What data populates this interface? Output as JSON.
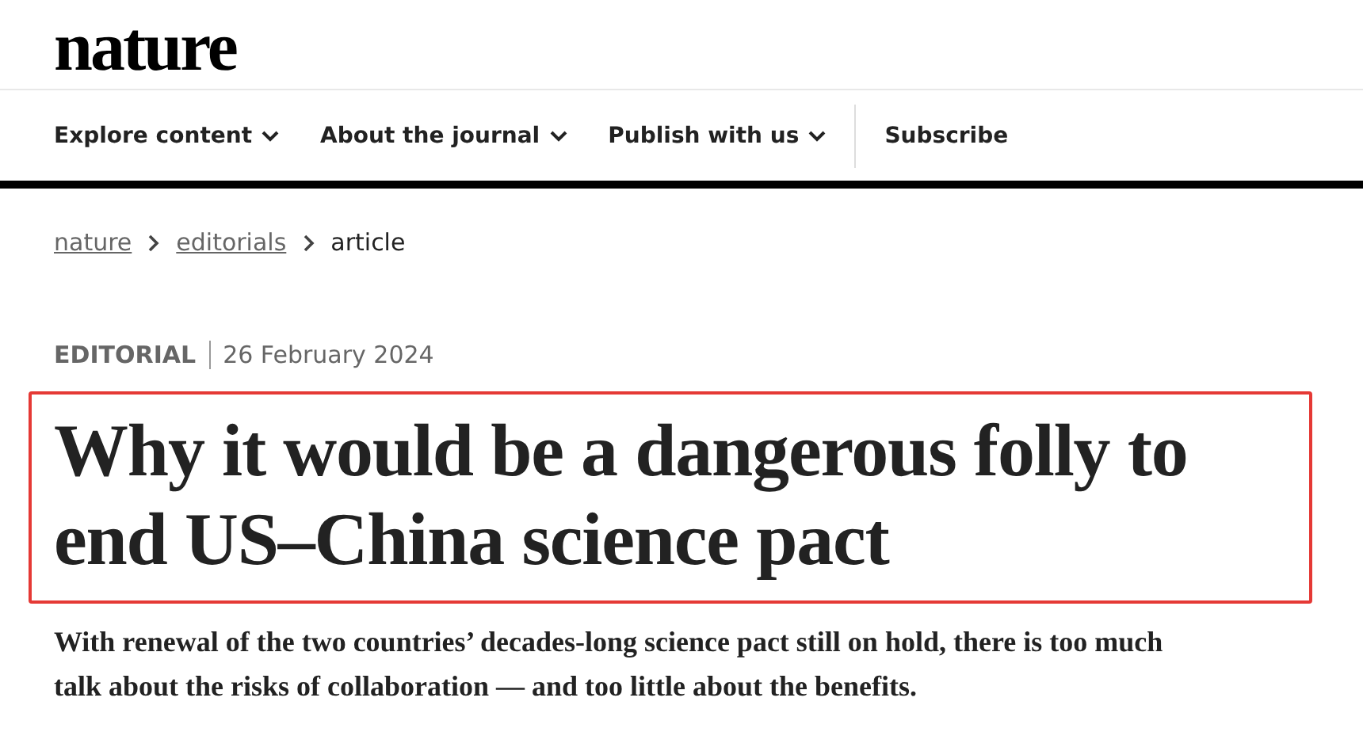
{
  "logo": "nature",
  "nav": [
    {
      "label": "Explore content",
      "has_menu": true
    },
    {
      "label": "About the journal",
      "has_menu": true
    },
    {
      "label": "Publish with us",
      "has_menu": true
    },
    {
      "label": "Subscribe",
      "has_menu": false
    }
  ],
  "breadcrumbs": [
    {
      "label": "nature",
      "current": false
    },
    {
      "label": "editorials",
      "current": false
    },
    {
      "label": "article",
      "current": true
    }
  ],
  "article": {
    "type": "EDITORIAL",
    "date": "26 February 2024",
    "title": "Why it would be a dangerous folly to end US–China science pact",
    "title_highlighted": true,
    "standfirst": "With renewal of the two countries’ decades-long science pact still on hold, there is too much talk about the risks of collaboration — and too little about the benefits."
  }
}
